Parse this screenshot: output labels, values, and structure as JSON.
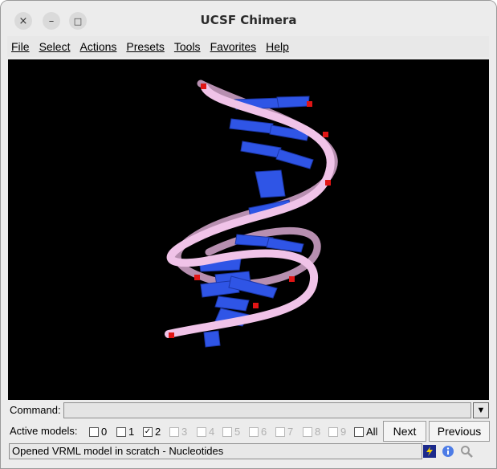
{
  "window": {
    "title": "UCSF Chimera",
    "controls": {
      "close": "×",
      "minimize": "–",
      "maximize": "□"
    }
  },
  "menu": [
    "File",
    "Select",
    "Actions",
    "Presets",
    "Tools",
    "Favorites",
    "Help"
  ],
  "command": {
    "label": "Command:",
    "value": "",
    "dropdown_glyph": "▼"
  },
  "models": {
    "label": "Active models:",
    "items": [
      {
        "label": "0",
        "checked": false,
        "enabled": true
      },
      {
        "label": "1",
        "checked": false,
        "enabled": true
      },
      {
        "label": "2",
        "checked": true,
        "enabled": true
      },
      {
        "label": "3",
        "checked": false,
        "enabled": false
      },
      {
        "label": "4",
        "checked": false,
        "enabled": false
      },
      {
        "label": "5",
        "checked": false,
        "enabled": false
      },
      {
        "label": "6",
        "checked": false,
        "enabled": false
      },
      {
        "label": "7",
        "checked": false,
        "enabled": false
      },
      {
        "label": "8",
        "checked": false,
        "enabled": false
      },
      {
        "label": "9",
        "checked": false,
        "enabled": false
      },
      {
        "label": "All",
        "checked": false,
        "enabled": true
      }
    ],
    "next_label": "Next",
    "previous_label": "Previous"
  },
  "status": {
    "message": "Opened VRML model in scratch - Nucleotides",
    "icons": [
      "lightning-icon",
      "info-icon",
      "magnifier-icon"
    ]
  },
  "viewport": {
    "background": "#000000",
    "backbone_color": "#f0c3e8",
    "base_color": "#2f55e6",
    "phosphate_color": "#e01515"
  }
}
